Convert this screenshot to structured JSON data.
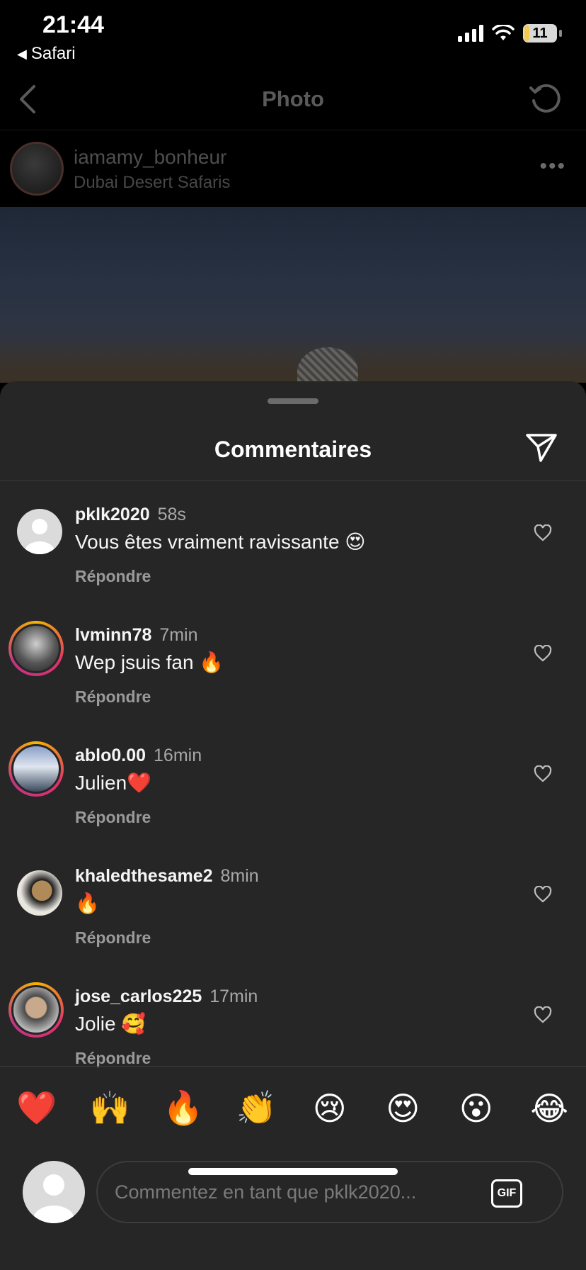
{
  "status_bar": {
    "time": "21:44",
    "back_app": "Safari",
    "battery": "11"
  },
  "post_header": {
    "title": "Photo",
    "username": "iamamy_bonheur",
    "location": "Dubai Desert Safaris"
  },
  "sheet": {
    "title": "Commentaires",
    "comments": [
      {
        "username": "pklk2020",
        "time": "58s",
        "text": "Vous êtes vraiment ravissante 😍",
        "reply": "Répondre"
      },
      {
        "username": "lvminn78",
        "time": "7min",
        "text": "Wep jsuis fan 🔥",
        "reply": "Répondre"
      },
      {
        "username": "ablo0.00",
        "time": "16min",
        "text": "Julien❤️",
        "reply": "Répondre"
      },
      {
        "username": "khaledthesame2",
        "time": "8min",
        "text": "🔥",
        "reply": "Répondre"
      },
      {
        "username": "jose_carlos225",
        "time": "17min",
        "text": "Jolie 🥰",
        "reply": "Répondre"
      }
    ],
    "quick_emojis": [
      "❤️",
      "🙌",
      "🔥",
      "👏",
      "😢",
      "😍",
      "😮",
      "😂"
    ],
    "input": {
      "placeholder": "Commentez en tant que pklk2020...",
      "value": "",
      "gif_label": "GIF"
    }
  },
  "colors": {
    "sheet_bg": "#262626",
    "secondary_text": "#a8a8a8",
    "ring_start": "#f7b500",
    "ring_end": "#c13584"
  }
}
